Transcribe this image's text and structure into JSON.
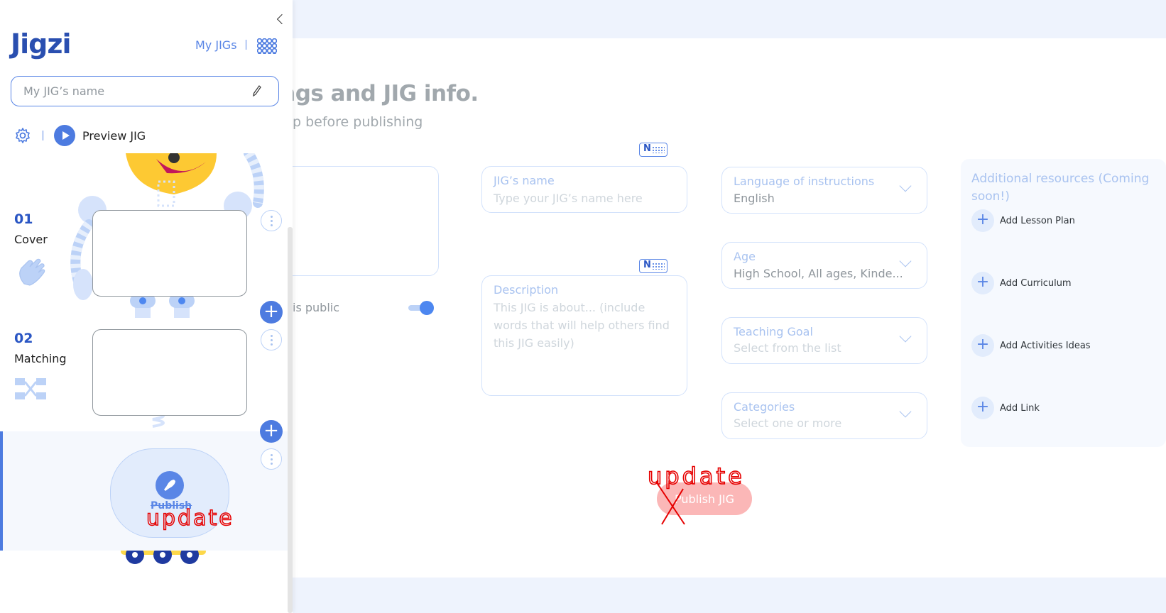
{
  "sidebar": {
    "logo": "Jigzi",
    "my_jigs": "My JIGs",
    "jig_name_placeholder": "My JIG’s name",
    "preview_label": "Preview JIG",
    "modules": [
      {
        "number": "01",
        "name": "Cover"
      },
      {
        "number": "02",
        "name": "Matching"
      }
    ],
    "publish_label": "Publish",
    "publish_annotation": "update"
  },
  "main": {
    "heading": "ings and JIG info.",
    "subheading": "p before publishing",
    "public_label": "is public",
    "public_on": true,
    "jig_name": {
      "label": "JIG’s name",
      "placeholder": "Type your JIG’s name here"
    },
    "description": {
      "label": "Description",
      "placeholder": "This JIG is about... (include words that will help others find this JIG easily)"
    },
    "language": {
      "label": "Language of instructions",
      "value": "English"
    },
    "age": {
      "label": "Age",
      "value": "High School, All ages, Kinde..."
    },
    "teaching_goal": {
      "label": "Teaching Goal",
      "placeholder": "Select from the list"
    },
    "categories": {
      "label": "Categories",
      "placeholder": "Select one or more"
    },
    "resources": {
      "title": "Additional resources (Coming soon!)",
      "items": [
        "Add Lesson Plan",
        "Add Curriculum",
        "Add Activities Ideas",
        "Add Link"
      ]
    },
    "publish_button": "Publish JIG",
    "publish_annotation": "update"
  },
  "colors": {
    "accent": "#4d7be0",
    "publish_button": "#fbb7b7",
    "annotation": "#e60000"
  },
  "icons": [
    "collapse-chevron-icon",
    "apps-grid-icon",
    "pencil-icon",
    "gear-icon",
    "play-icon",
    "keyboard-icon",
    "chevron-down-icon",
    "plus-icon",
    "kebab-menu-icon",
    "rocket-icon",
    "wave-hand-icon",
    "matching-icon"
  ]
}
